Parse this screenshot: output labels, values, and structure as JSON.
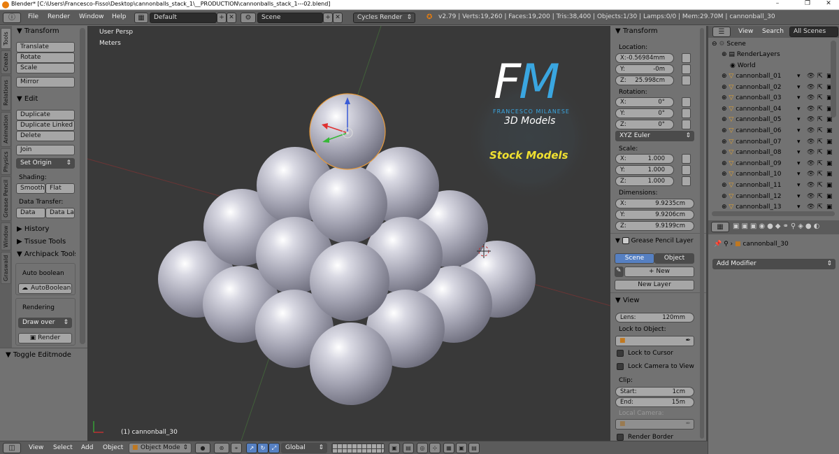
{
  "window": {
    "title": "Blender* [C:\\Users\\Francesco-Fisso\\Desktop\\cannonballs_stack_1\\__PRODUCTION\\cannonballs_stack_1---02.blend]",
    "minimize": "–",
    "maximize": "❐",
    "close": "✕"
  },
  "infobar": {
    "menus": [
      "File",
      "Render",
      "Window",
      "Help"
    ],
    "screen_layout": "Default",
    "scene": "Scene",
    "engine": "Cycles Render",
    "stats": "v2.79 | Verts:19,260 | Faces:19,200 | Tris:38,400 | Objects:1/30 | Lamps:0/0 | Mem:29.70M | cannonball_30"
  },
  "toolshelf": {
    "tabs": [
      "Tools",
      "Create",
      "Relations",
      "Animation",
      "Physics",
      "Grease Pencil",
      "Window",
      "Graswald"
    ],
    "transform": {
      "title": "Transform",
      "translate": "Translate",
      "rotate": "Rotate",
      "scale": "Scale",
      "mirror": "Mirror"
    },
    "edit": {
      "title": "Edit",
      "duplicate": "Duplicate",
      "duplicate_linked": "Duplicate Linked",
      "delete": "Delete",
      "join": "Join",
      "set_origin": "Set Origin",
      "shading_label": "Shading:",
      "smooth": "Smooth",
      "flat": "Flat",
      "data_transfer_label": "Data Transfer:",
      "data": "Data",
      "data_la": "Data La"
    },
    "history": "History",
    "tissue_tools": "Tissue Tools",
    "archipack": {
      "title": "Archipack Tools",
      "auto_boolean_label": "Auto boolean",
      "auto_boolean_btn": "AutoBoolean",
      "rendering_label": "Rendering",
      "draw_over": "Draw over",
      "render": "Render"
    },
    "toggle_editmode": "Toggle Editmode"
  },
  "viewport": {
    "view_name": "User Persp",
    "units": "Meters",
    "active_object": "(1) cannonball_30",
    "watermark": {
      "initials_f": "F",
      "initials_m": "M",
      "name": "FRANCESCO MILANESE",
      "subtitle": "3D Models",
      "badge": "Stock Models"
    }
  },
  "npanel": {
    "transform_title": "Transform",
    "location_label": "Location:",
    "location": {
      "x": "-0.56984mm",
      "y": "-0m",
      "z": "25.998cm"
    },
    "rotation_label": "Rotation:",
    "rotation": {
      "x": "0°",
      "y": "0°",
      "z": "0°"
    },
    "rotation_mode": "XYZ Euler",
    "scale_label": "Scale:",
    "scale": {
      "x": "1.000",
      "y": "1.000",
      "z": "1.000"
    },
    "dimensions_label": "Dimensions:",
    "dimensions": {
      "x": "9.9235cm",
      "y": "9.9206cm",
      "z": "9.9199cm"
    },
    "axis": {
      "x": "X:",
      "y": "Y:",
      "z": "Z:"
    },
    "grease_title": "Grease Pencil Layer",
    "scene_tab": "Scene",
    "object_tab": "Object",
    "new": "New",
    "new_layer": "New Layer",
    "view_title": "View",
    "lens_label": "Lens:",
    "lens": "120mm",
    "lock_to_object": "Lock to Object:",
    "lock_to_cursor": "Lock to Cursor",
    "lock_camera": "Lock Camera to View",
    "clip_label": "Clip:",
    "clip_start_label": "Start:",
    "clip_start": "1cm",
    "clip_end_label": "End:",
    "clip_end": "15m",
    "local_camera": "Local Camera:",
    "render_border": "Render Border"
  },
  "outliner": {
    "view": "View",
    "search": "Search",
    "all_scenes": "All Scenes",
    "scene": "Scene",
    "render_layers": "RenderLayers",
    "world": "World",
    "objects": [
      "cannonball_01",
      "cannonball_02",
      "cannonball_03",
      "cannonball_04",
      "cannonball_05",
      "cannonball_06",
      "cannonball_07",
      "cannonball_08",
      "cannonball_09",
      "cannonball_10",
      "cannonball_11",
      "cannonball_12",
      "cannonball_13"
    ]
  },
  "properties": {
    "object_name": "cannonball_30",
    "add_modifier": "Add Modifier"
  },
  "bottombar": {
    "menus": [
      "View",
      "Select",
      "Add",
      "Object"
    ],
    "mode": "Object Mode",
    "orientation": "Global"
  },
  "colors": {
    "accent_blue": "#5680c2",
    "selection_orange": "#e89b3c",
    "bg_dark": "#393939",
    "panel": "#727272"
  }
}
